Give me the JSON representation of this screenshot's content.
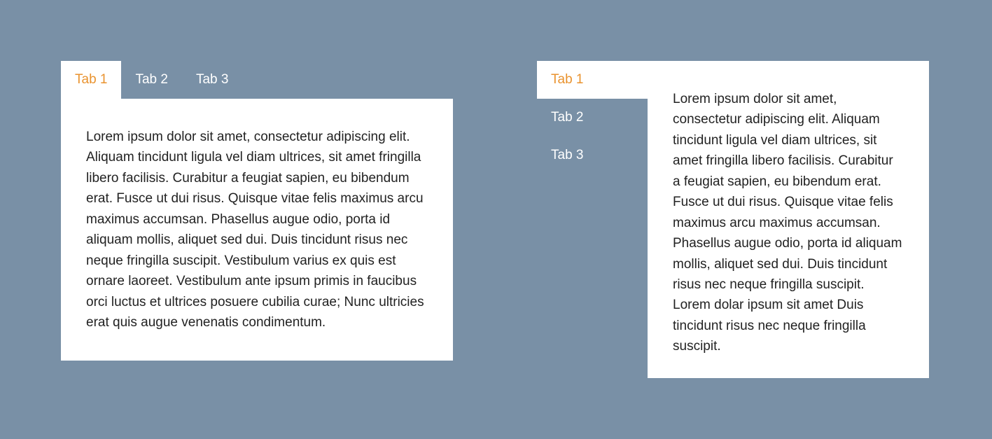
{
  "horizontal_tabs": {
    "tabs": [
      {
        "label": "Tab 1"
      },
      {
        "label": "Tab 2"
      },
      {
        "label": "Tab 3"
      }
    ],
    "panel_content": "Lorem ipsum dolor sit amet, consectetur adipiscing elit. Aliquam tincidunt ligula vel diam ultrices, sit amet fringilla libero facilisis. Curabitur a feugiat sapien, eu bibendum erat. Fusce ut dui risus. Quisque vitae felis maximus arcu maximus accumsan. Phasellus augue odio, porta id aliquam mollis, aliquet sed dui. Duis tincidunt risus nec neque fringilla suscipit. Vestibulum varius ex quis est ornare laoreet. Vestibulum ante ipsum primis in faucibus orci luctus et ultrices posuere cubilia curae; Nunc ultricies erat quis augue venenatis condimentum."
  },
  "vertical_tabs": {
    "tabs": [
      {
        "label": "Tab 1"
      },
      {
        "label": "Tab 2"
      },
      {
        "label": "Tab 3"
      }
    ],
    "panel_content": "Lorem ipsum dolor sit amet, consectetur adipiscing elit. Aliquam tincidunt ligula vel diam ultrices, sit amet fringilla libero facilisis. Curabitur a feugiat sapien, eu bibendum erat. Fusce ut dui risus. Quisque vitae felis maximus arcu maximus accumsan. Phasellus augue odio, porta id aliquam mollis, aliquet sed dui. Duis tincidunt risus nec neque fringilla suscipit. Lorem dolar ipsum sit amet Duis tincidunt risus nec neque fringilla suscipit."
  }
}
